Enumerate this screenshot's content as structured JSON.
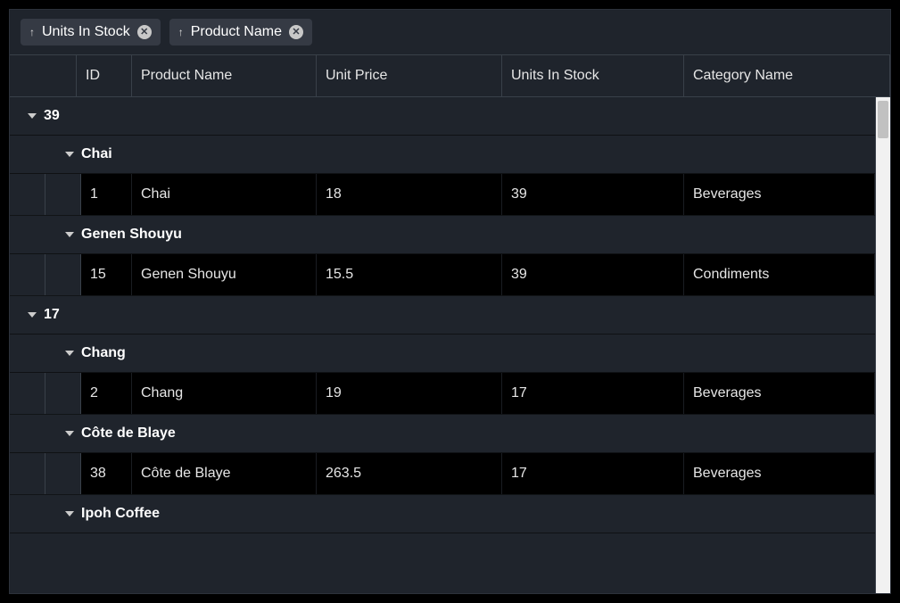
{
  "grouping": {
    "chips": [
      {
        "label": "Units In Stock",
        "direction": "asc"
      },
      {
        "label": "Product Name",
        "direction": "asc"
      }
    ]
  },
  "columns": {
    "id": "ID",
    "product_name": "Product Name",
    "unit_price": "Unit Price",
    "units_in_stock": "Units In Stock",
    "category_name": "Category Name"
  },
  "groups": [
    {
      "key": "39",
      "subgroups": [
        {
          "key": "Chai",
          "rows": [
            {
              "id": "1",
              "product_name": "Chai",
              "unit_price": "18",
              "units_in_stock": "39",
              "category_name": "Beverages"
            }
          ]
        },
        {
          "key": "Genen Shouyu",
          "rows": [
            {
              "id": "15",
              "product_name": "Genen Shouyu",
              "unit_price": "15.5",
              "units_in_stock": "39",
              "category_name": "Condiments"
            }
          ]
        }
      ]
    },
    {
      "key": "17",
      "subgroups": [
        {
          "key": "Chang",
          "rows": [
            {
              "id": "2",
              "product_name": "Chang",
              "unit_price": "19",
              "units_in_stock": "17",
              "category_name": "Beverages"
            }
          ]
        },
        {
          "key": "Côte de Blaye",
          "rows": [
            {
              "id": "38",
              "product_name": "Côte de Blaye",
              "unit_price": "263.5",
              "units_in_stock": "17",
              "category_name": "Beverages"
            }
          ]
        },
        {
          "key": "Ipoh Coffee",
          "rows": []
        }
      ]
    }
  ]
}
